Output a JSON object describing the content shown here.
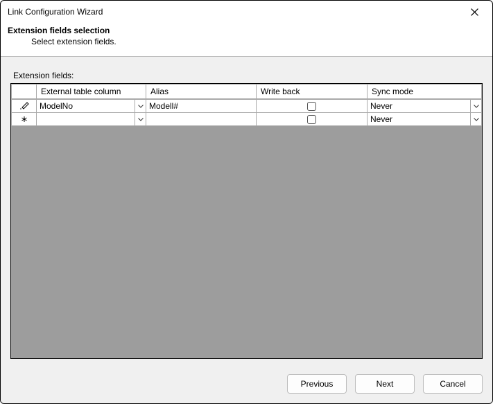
{
  "window": {
    "title": "Link Configuration Wizard"
  },
  "header": {
    "heading": "Extension fields selection",
    "subheading": "Select extension fields."
  },
  "fields_label": "Extension fields:",
  "table": {
    "columns": {
      "external": "External table column",
      "alias": "Alias",
      "write_back": "Write back",
      "sync_mode": "Sync mode"
    },
    "rows": [
      {
        "indicator": "edit",
        "external": "ModelNo",
        "alias": "Modell#",
        "write_back": false,
        "sync_mode": "Never"
      },
      {
        "indicator": "new",
        "external": "",
        "alias": "",
        "write_back": false,
        "sync_mode": "Never"
      }
    ]
  },
  "buttons": {
    "previous": "Previous",
    "next": "Next",
    "cancel": "Cancel"
  }
}
